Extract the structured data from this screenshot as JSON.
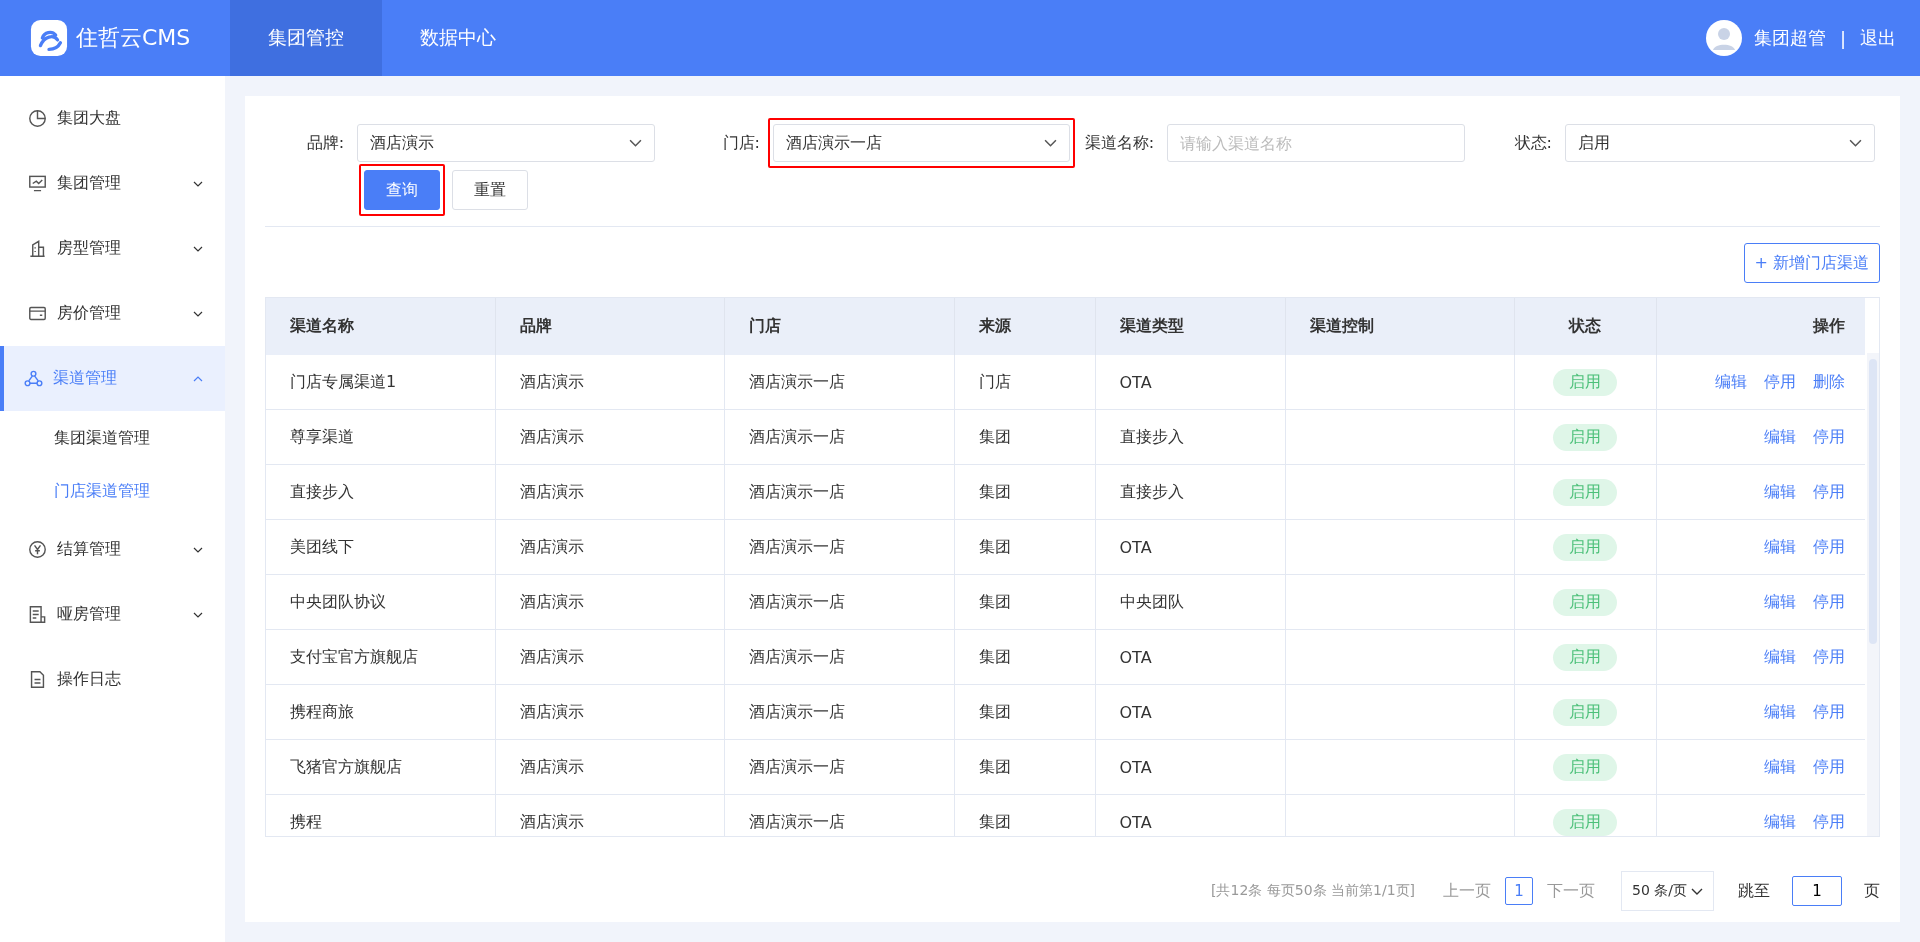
{
  "header": {
    "logo_text": "住哲云CMS",
    "nav": [
      {
        "label": "集团管控",
        "selected": true
      },
      {
        "label": "数据中心",
        "selected": false
      }
    ],
    "user": "集团超管",
    "separator": "|",
    "logout": "退出"
  },
  "sidebar": {
    "items": [
      {
        "label": "集团大盘",
        "selected": false
      },
      {
        "label": "集团管理",
        "expanded": false,
        "selected": false
      },
      {
        "label": "房型管理",
        "expanded": false,
        "selected": false
      },
      {
        "label": "房价管理",
        "expanded": false,
        "selected": false
      },
      {
        "label": "渠道管理",
        "expanded": true,
        "selected": true,
        "children": [
          {
            "label": "集团渠道管理",
            "selected": false
          },
          {
            "label": "门店渠道管理",
            "selected": true
          }
        ]
      },
      {
        "label": "结算管理",
        "expanded": false,
        "selected": false
      },
      {
        "label": "哑房管理",
        "expanded": false,
        "selected": false
      },
      {
        "label": "操作日志",
        "selected": false
      }
    ]
  },
  "filters": [
    {
      "kind": "select",
      "label": "品牌:",
      "value": "酒店演示",
      "highlighted": false
    },
    {
      "kind": "select",
      "label": "门店:",
      "value": "酒店演示一店",
      "highlighted": true
    },
    {
      "kind": "input",
      "label": "渠道名称:",
      "placeholder": "请输入渠道名称",
      "highlighted": false
    },
    {
      "kind": "select",
      "label": "状态:",
      "value": "启用",
      "highlighted": false
    }
  ],
  "buttons": [
    {
      "label": "查询",
      "kind": "primary",
      "highlighted": true
    },
    {
      "label": "重置",
      "kind": "default",
      "highlighted": false
    }
  ],
  "add_button": "+ 新增门店渠道",
  "table": {
    "columns": [
      "渠道名称",
      "品牌",
      "门店",
      "来源",
      "渠道类型",
      "渠道控制",
      "状态",
      "操作"
    ],
    "rows": [
      {
        "name": "门店专属渠道1",
        "brand": "酒店演示",
        "store": "酒店演示一店",
        "source": "门店",
        "type": "OTA",
        "status": "启用",
        "actions": [
          "编辑",
          "停用",
          "删除"
        ]
      },
      {
        "name": "尊享渠道",
        "brand": "酒店演示",
        "store": "酒店演示一店",
        "source": "集团",
        "type": "直接步入",
        "status": "启用",
        "actions": [
          "编辑",
          "停用"
        ]
      },
      {
        "name": "直接步入",
        "brand": "酒店演示",
        "store": "酒店演示一店",
        "source": "集团",
        "type": "直接步入",
        "status": "启用",
        "actions": [
          "编辑",
          "停用"
        ]
      },
      {
        "name": "美团线下",
        "brand": "酒店演示",
        "store": "酒店演示一店",
        "source": "集团",
        "type": "OTA",
        "status": "启用",
        "actions": [
          "编辑",
          "停用"
        ]
      },
      {
        "name": "中央团队协议",
        "brand": "酒店演示",
        "store": "酒店演示一店",
        "source": "集团",
        "type": "中央团队",
        "status": "启用",
        "actions": [
          "编辑",
          "停用"
        ]
      },
      {
        "name": "支付宝官方旗舰店",
        "brand": "酒店演示",
        "store": "酒店演示一店",
        "source": "集团",
        "type": "OTA",
        "status": "启用",
        "actions": [
          "编辑",
          "停用"
        ]
      },
      {
        "name": "携程商旅",
        "brand": "酒店演示",
        "store": "酒店演示一店",
        "source": "集团",
        "type": "OTA",
        "status": "启用",
        "actions": [
          "编辑",
          "停用"
        ]
      },
      {
        "name": "飞猪官方旗舰店",
        "brand": "酒店演示",
        "store": "酒店演示一店",
        "source": "集团",
        "type": "OTA",
        "status": "启用",
        "actions": [
          "编辑",
          "停用"
        ]
      },
      {
        "name": "携程",
        "brand": "酒店演示",
        "store": "酒店演示一店",
        "source": "集团",
        "type": "OTA",
        "status": "启用",
        "actions": [
          "编辑",
          "停用"
        ]
      }
    ]
  },
  "pagination": {
    "summary": "[共12条 每页50条 当前第1/1页]",
    "prev": "上一页",
    "pages": [
      {
        "label": "1",
        "selected": true
      }
    ],
    "next": "下一页",
    "page_size": "50 条/页",
    "jump_label": "跳至",
    "jump_value": "1",
    "page_unit": "页"
  }
}
